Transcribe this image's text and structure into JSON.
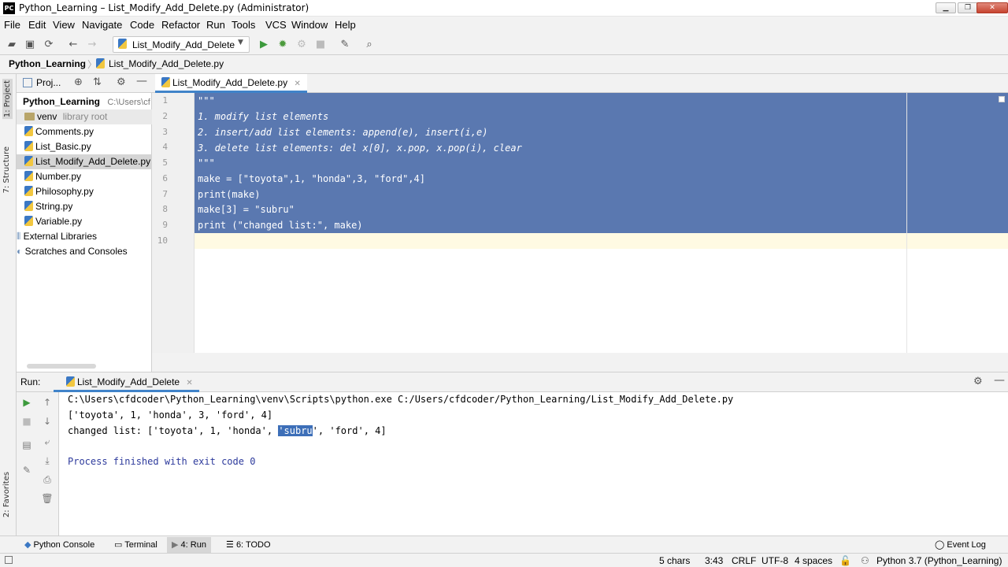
{
  "window": {
    "title": "Python_Learning – List_Modify_Add_Delete.py (Administrator)",
    "logo_text": "PC"
  },
  "menu": [
    "File",
    "Edit",
    "View",
    "Navigate",
    "Code",
    "Refactor",
    "Run",
    "Tools",
    "VCS",
    "Window",
    "Help"
  ],
  "toolbar": {
    "run_config_label": "List_Modify_Add_Delete"
  },
  "breadcrumb": {
    "project": "Python_Learning",
    "file": "List_Modify_Add_Delete.py"
  },
  "left_strip": {
    "project_tab": "1: Project",
    "structure_tab": "7: Structure",
    "favorites_tab": "2: Favorites"
  },
  "project_panel": {
    "header_label": "Proj...",
    "root_name": "Python_Learning",
    "root_path": "C:\\Users\\cf",
    "venv_name": "venv",
    "venv_hint": "library root",
    "files": [
      "Comments.py",
      "List_Basic.py",
      "List_Modify_Add_Delete.py",
      "Number.py",
      "Philosophy.py",
      "String.py",
      "Variable.py"
    ],
    "external_libraries": "External Libraries",
    "scratches": "Scratches and Consoles"
  },
  "editor": {
    "tab_label": "List_Modify_Add_Delete.py",
    "line_numbers": [
      "1",
      "2",
      "3",
      "4",
      "5",
      "6",
      "7",
      "8",
      "9",
      "10"
    ],
    "lines": [
      "\"\"\"",
      "1. modify list elements",
      "2. insert/add list elements: append(e), insert(i,e)",
      "3. delete list elements: del x[0], x.pop, x.pop(i), clear",
      "\"\"\"",
      "make = [\"toyota\",1, \"honda\",3, \"ford\",4]",
      "print(make)",
      "make[3] = \"subru\"",
      "print (\"changed list:\", make)",
      ""
    ]
  },
  "run_panel": {
    "label": "Run:",
    "tab_label": "List_Modify_Add_Delete",
    "console": {
      "command": "C:\\Users\\cfdcoder\\Python_Learning\\venv\\Scripts\\python.exe C:/Users/cfdcoder/Python_Learning/List_Modify_Add_Delete.py",
      "output1": "['toyota', 1, 'honda', 3, 'ford', 4]",
      "output2_prefix": "changed list: ['toyota', 1, 'honda', ",
      "output2_selected": "'subru",
      "output2_suffix": "', 'ford', 4]",
      "exit": "Process finished with exit code 0"
    }
  },
  "bottom_tabs": {
    "python_console": "Python Console",
    "terminal": "Terminal",
    "run": "4: Run",
    "todo": "6: TODO",
    "event_log": "Event Log"
  },
  "status": {
    "chars": "5 chars",
    "position": "3:43",
    "line_sep": "CRLF",
    "encoding": "UTF-8",
    "indent": "4 spaces",
    "interpreter": "Python 3.7 (Python_Learning)"
  },
  "colors": {
    "selection": "#5a78b0",
    "tab_accent": "#4083c9",
    "run_green": "#3c9a3c"
  }
}
